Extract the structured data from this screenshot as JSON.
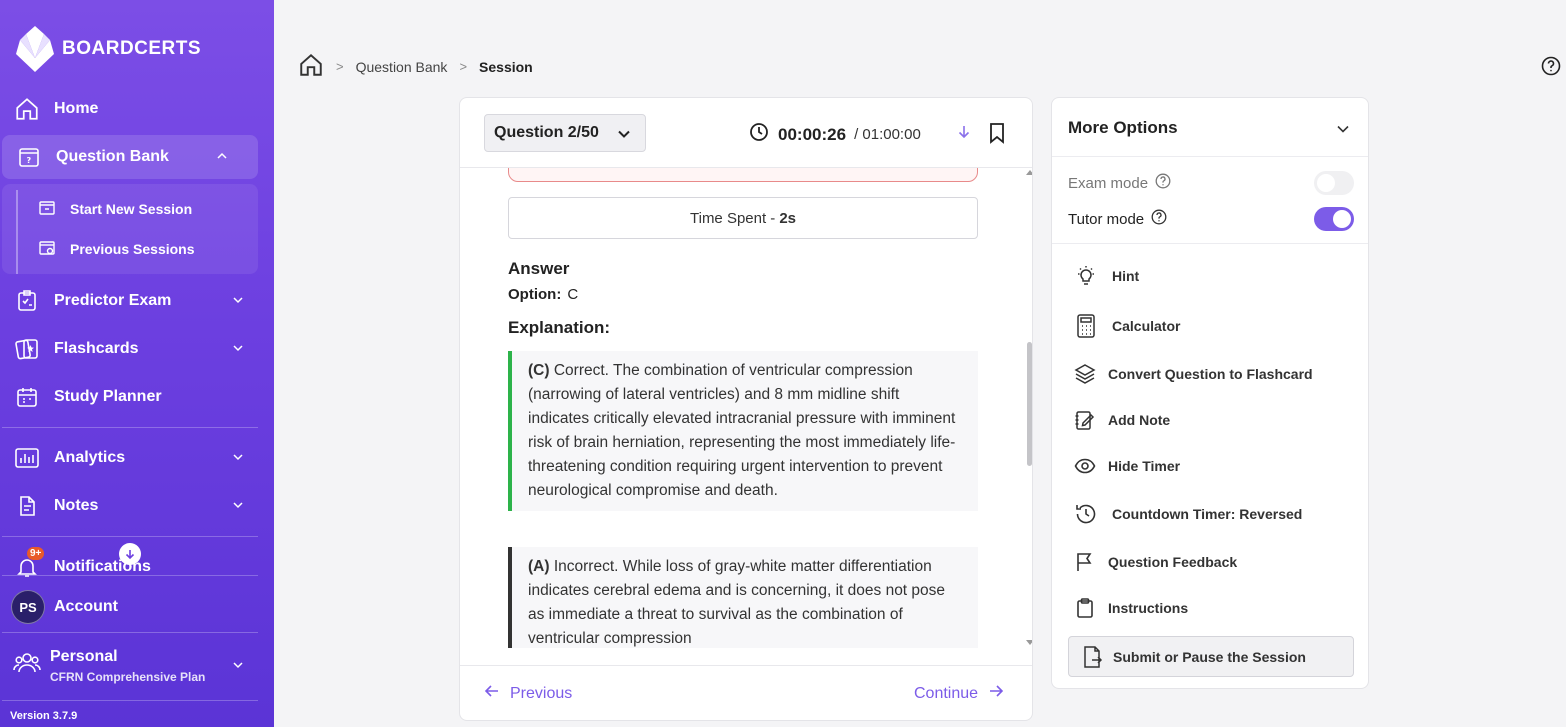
{
  "brand": {
    "name": "BOARDCERTS"
  },
  "sidebar": {
    "home": "Home",
    "question_bank": "Question Bank",
    "start_new_session": "Start New Session",
    "previous_sessions": "Previous Sessions",
    "predictor_exam": "Predictor Exam",
    "flashcards": "Flashcards",
    "study_planner": "Study Planner",
    "analytics": "Analytics",
    "notes": "Notes",
    "notifications": "Notifications",
    "notifications_badge": "9+",
    "account_initials": "PS",
    "account": "Account",
    "plan_title": "Personal",
    "plan_name": "CFRN Comprehensive Plan",
    "version": "Version 3.7.9"
  },
  "breadcrumb": {
    "level1": "Question Bank",
    "level2": "Session"
  },
  "question": {
    "selector": "Question 2/50",
    "elapsed": "00:00:26",
    "total": "/ 01:00:00",
    "time_spent_label": "Time Spent - ",
    "time_spent_value": "2s",
    "answer_heading": "Answer",
    "option_label": "Option:",
    "option_value": "C",
    "explanation_heading": "Explanation:",
    "explanations": [
      {
        "tag": "(C)",
        "text": " Correct. The combination of ventricular compression (narrowing of lateral ventricles) and 8 mm midline shift indicates critically elevated intracranial pressure with imminent risk of brain herniation, representing the most immediately life-threatening condition requiring urgent intervention to prevent neurological compromise and death."
      },
      {
        "tag": "(A)",
        "text": " Incorrect. While loss of gray-white matter differentiation indicates cerebral edema and is concerning, it does not pose as immediate a threat to survival as the combination of ventricular compression"
      }
    ],
    "prev_label": "Previous",
    "next_label": "Continue"
  },
  "options": {
    "title": "More Options",
    "exam_mode": "Exam mode",
    "exam_mode_on": false,
    "tutor_mode": "Tutor mode",
    "tutor_mode_on": true,
    "items": {
      "hint": "Hint",
      "calculator": "Calculator",
      "convert": "Convert Question to Flashcard",
      "add_note": "Add Note",
      "hide_timer": "Hide Timer",
      "countdown": "Countdown Timer: Reversed",
      "feedback": "Question Feedback",
      "instructions": "Instructions"
    },
    "submit": "Submit or Pause the Session"
  },
  "colors": {
    "brand": "#6c3fe0",
    "accent": "#7c5ce8",
    "correct": "#2db34a"
  }
}
